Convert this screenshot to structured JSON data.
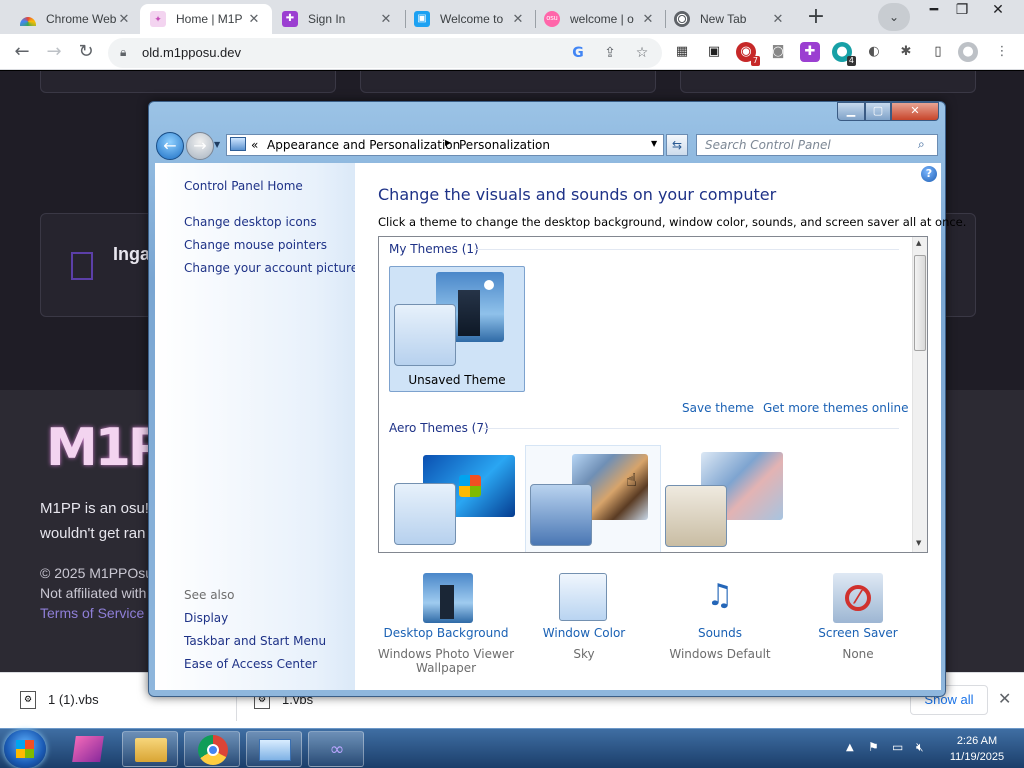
{
  "browser": {
    "tabs": [
      {
        "title": "Chrome Web",
        "favicon": "rainbow-icon",
        "active": false
      },
      {
        "title": "Home | M1P",
        "favicon": "m1pp-icon",
        "active": true
      },
      {
        "title": "Sign In",
        "favicon": "puzzle-icon",
        "active": false
      },
      {
        "title": "Welcome to",
        "favicon": "lock-icon",
        "active": false
      },
      {
        "title": "welcome | o",
        "favicon": "osu-icon",
        "active": false
      },
      {
        "title": "New Tab",
        "favicon": "chrome-icon",
        "active": false
      }
    ],
    "url": "old.m1pposu.dev",
    "extension_badges": {
      "badge_7": "7",
      "badge_4": "4"
    }
  },
  "site": {
    "card_text": "Inga",
    "description_line1": "M1PP is an osu!",
    "description_line2": "wouldn't get ran",
    "copyright": "© 2025 M1PPOsu",
    "not_affiliated": "Not affiliated with",
    "terms_link": "Terms of Service"
  },
  "downloads": {
    "items": [
      {
        "name": "1 (1).vbs"
      },
      {
        "name": "1.vbs"
      }
    ],
    "show_all": "Show all"
  },
  "window": {
    "breadcrumb": {
      "prefix": "«",
      "item1": "Appearance and Personalization",
      "item2": "Personalization"
    },
    "search_placeholder": "Search Control Panel",
    "left_nav": {
      "home": "Control Panel Home",
      "links": [
        "Change desktop icons",
        "Change mouse pointers",
        "Change your account picture"
      ],
      "see_also": "See also",
      "see_also_links": [
        "Display",
        "Taskbar and Start Menu",
        "Ease of Access Center"
      ]
    },
    "main": {
      "title": "Change the visuals and sounds on your computer",
      "subtitle": "Click a theme to change the desktop background, window color, sounds, and screen saver all at once.",
      "my_themes_header": "My Themes (1)",
      "unsaved_theme": "Unsaved Theme",
      "save_theme": "Save theme",
      "get_more_themes": "Get more themes online",
      "aero_themes_header": "Aero Themes (7)"
    },
    "bottom": [
      {
        "label": "Desktop Background",
        "sub1": "Windows Photo Viewer",
        "sub2": "Wallpaper",
        "icon": "lighthouse-picture-icon"
      },
      {
        "label": "Window Color",
        "sub1": "Sky",
        "sub2": "",
        "icon": "window-color-swatch-icon"
      },
      {
        "label": "Sounds",
        "sub1": "Windows Default",
        "sub2": "",
        "icon": "piano-music-icon"
      },
      {
        "label": "Screen Saver",
        "sub1": "None",
        "sub2": "",
        "icon": "no-screensaver-icon"
      }
    ]
  },
  "taskbar": {
    "time": "2:26 AM",
    "date": "11/19/2025"
  },
  "colors": {
    "link_blue": "#1a61b4",
    "nav_link": "#1e3287",
    "site_bg": "#1f1d26",
    "taskbar": "#1b3e6a"
  }
}
